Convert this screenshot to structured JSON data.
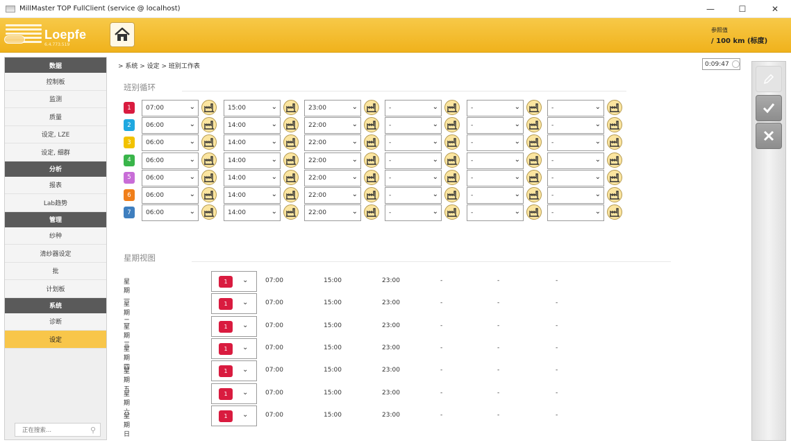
{
  "window": {
    "title": "MillMaster TOP FullClient (service @ localhost)",
    "min": "—",
    "max": "☐",
    "close": "✕"
  },
  "header": {
    "logo_text": "Loepfe",
    "logo_version": "6.4.773.519",
    "home_icon": "home-icon",
    "ref_label": "参照值",
    "ref_value": "/ 100 km (标度)"
  },
  "sidebar": {
    "groups": [
      {
        "title": "数据",
        "items": [
          "控制板",
          "监测",
          "质量",
          "设定, LZE",
          "设定, 细群"
        ]
      },
      {
        "title": "分析",
        "items": [
          "报表",
          "Lab趋势"
        ]
      },
      {
        "title": "管理",
        "items": [
          "纱种",
          "清纱器设定",
          "批",
          "计划板"
        ]
      },
      {
        "title": "系统",
        "items": [
          "诊断",
          "设定"
        ]
      }
    ],
    "active_item": "设定",
    "search_placeholder": "正在搜索...",
    "search_icon": "search-icon"
  },
  "breadcrumb": "> 系统 > 设定 > 班别工作表",
  "timer": "0:09:47",
  "shift_cycle": {
    "title": "班别循环",
    "rows": [
      {
        "num": "1",
        "color": "#d91b3f",
        "times": [
          "07:00",
          "15:00",
          "23:00",
          "-",
          "-",
          "-"
        ]
      },
      {
        "num": "2",
        "color": "#1fa8e0",
        "times": [
          "06:00",
          "14:00",
          "22:00",
          "-",
          "-",
          "-"
        ]
      },
      {
        "num": "3",
        "color": "#f2c200",
        "times": [
          "06:00",
          "14:00",
          "22:00",
          "-",
          "-",
          "-"
        ]
      },
      {
        "num": "4",
        "color": "#39b54a",
        "times": [
          "06:00",
          "14:00",
          "22:00",
          "-",
          "-",
          "-"
        ]
      },
      {
        "num": "5",
        "color": "#c86dd7",
        "times": [
          "06:00",
          "14:00",
          "22:00",
          "-",
          "-",
          "-"
        ]
      },
      {
        "num": "6",
        "color": "#f07f1a",
        "times": [
          "06:00",
          "14:00",
          "22:00",
          "-",
          "-",
          "-"
        ]
      },
      {
        "num": "7",
        "color": "#3f7fbf",
        "times": [
          "06:00",
          "14:00",
          "22:00",
          "-",
          "-",
          "-"
        ]
      }
    ],
    "factory_icon": "factory-icon"
  },
  "week_view": {
    "title": "星期视图",
    "days": [
      {
        "label": "星期一",
        "shift": "1",
        "times": [
          "07:00",
          "15:00",
          "23:00",
          "-",
          "-",
          "-"
        ]
      },
      {
        "label": "星期二",
        "shift": "1",
        "times": [
          "07:00",
          "15:00",
          "23:00",
          "-",
          "-",
          "-"
        ]
      },
      {
        "label": "星期三",
        "shift": "1",
        "times": [
          "07:00",
          "15:00",
          "23:00",
          "-",
          "-",
          "-"
        ]
      },
      {
        "label": "星期四",
        "shift": "1",
        "times": [
          "07:00",
          "15:00",
          "23:00",
          "-",
          "-",
          "-"
        ]
      },
      {
        "label": "星期五",
        "shift": "1",
        "times": [
          "07:00",
          "15:00",
          "23:00",
          "-",
          "-",
          "-"
        ]
      },
      {
        "label": "星期六",
        "shift": "1",
        "times": [
          "07:00",
          "15:00",
          "23:00",
          "-",
          "-",
          "-"
        ]
      },
      {
        "label": "星期日",
        "shift": "1",
        "times": [
          "07:00",
          "15:00",
          "23:00",
          "-",
          "-",
          "-"
        ]
      }
    ]
  },
  "actions": {
    "edit_icon": "pencil-icon",
    "accept_icon": "check-icon",
    "cancel_icon": "x-icon",
    "edit_enabled": false
  }
}
